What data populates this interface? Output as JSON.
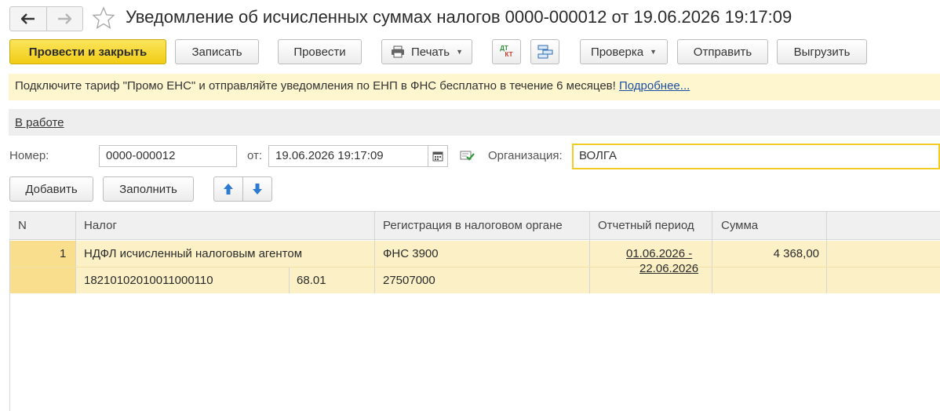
{
  "window": {
    "title": "Уведомление об исчисленных суммах налогов 0000-000012 от 19.06.2026 19:17:09"
  },
  "toolbar": {
    "post_close_label": "Провести и закрыть",
    "save_label": "Записать",
    "post_label": "Провести",
    "print_label": "Печать",
    "check_label": "Проверка",
    "send_label": "Отправить",
    "export_label": "Выгрузить",
    "dtkt_label_top": "ДТ",
    "dtkt_label_bottom": "КТ"
  },
  "banner": {
    "text": "Подключите тариф \"Промо ЕНС\" и отправляйте уведомления по ЕНП в ФНС бесплатно в течение 6 месяцев!",
    "link": "Подробнее..."
  },
  "status": {
    "label": "В работе"
  },
  "form": {
    "number_label": "Номер:",
    "number_value": "0000-000012",
    "date_label": "от:",
    "date_value": "19.06.2026 19:17:09",
    "org_label": "Организация:",
    "org_value": "ВОЛГА"
  },
  "table_toolbar": {
    "add_label": "Добавить",
    "fill_label": "Заполнить"
  },
  "table": {
    "headers": {
      "n": "N",
      "tax": "Налог",
      "registration": "Регистрация в налоговом органе",
      "period": "Отчетный период",
      "sum": "Сумма"
    },
    "rows": [
      {
        "n": "1",
        "tax_name": "НДФЛ исчисленный налоговым агентом",
        "kbk": "18210102010011000110",
        "account": "68.01",
        "registration": "ФНС 3900",
        "oktmo": "27507000",
        "period_line1": "01.06.2026 -",
        "period_line2": "22.06.2026",
        "sum": "4 368,00"
      }
    ]
  }
}
